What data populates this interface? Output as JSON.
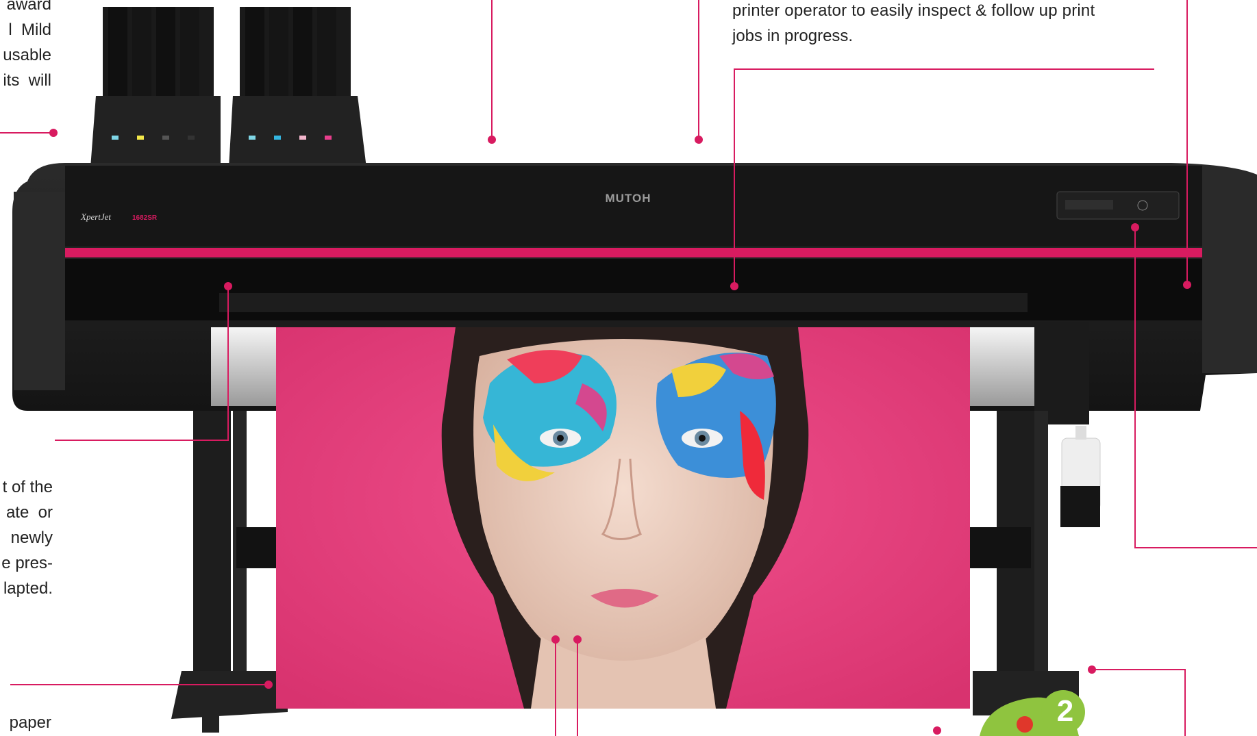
{
  "top_left_text": [
    "award",
    "l  Mild",
    "usable",
    "its  will"
  ],
  "top_right_text": [
    "printer operator to easily inspect & follow up print",
    "jobs in progress."
  ],
  "mid_left_text": [
    "t of the",
    "ate  or",
    "newly",
    "e pres-",
    "lapted."
  ],
  "bottom_left_text": [
    "paper"
  ],
  "printer": {
    "brand": "MUTOH",
    "model": "XpertJet",
    "model_code": "1682SR"
  },
  "badge": {
    "number": "2"
  },
  "colors": {
    "accent": "#d81b60",
    "printer_body": "#1b1b1b",
    "print_background": "#e73f7f"
  }
}
